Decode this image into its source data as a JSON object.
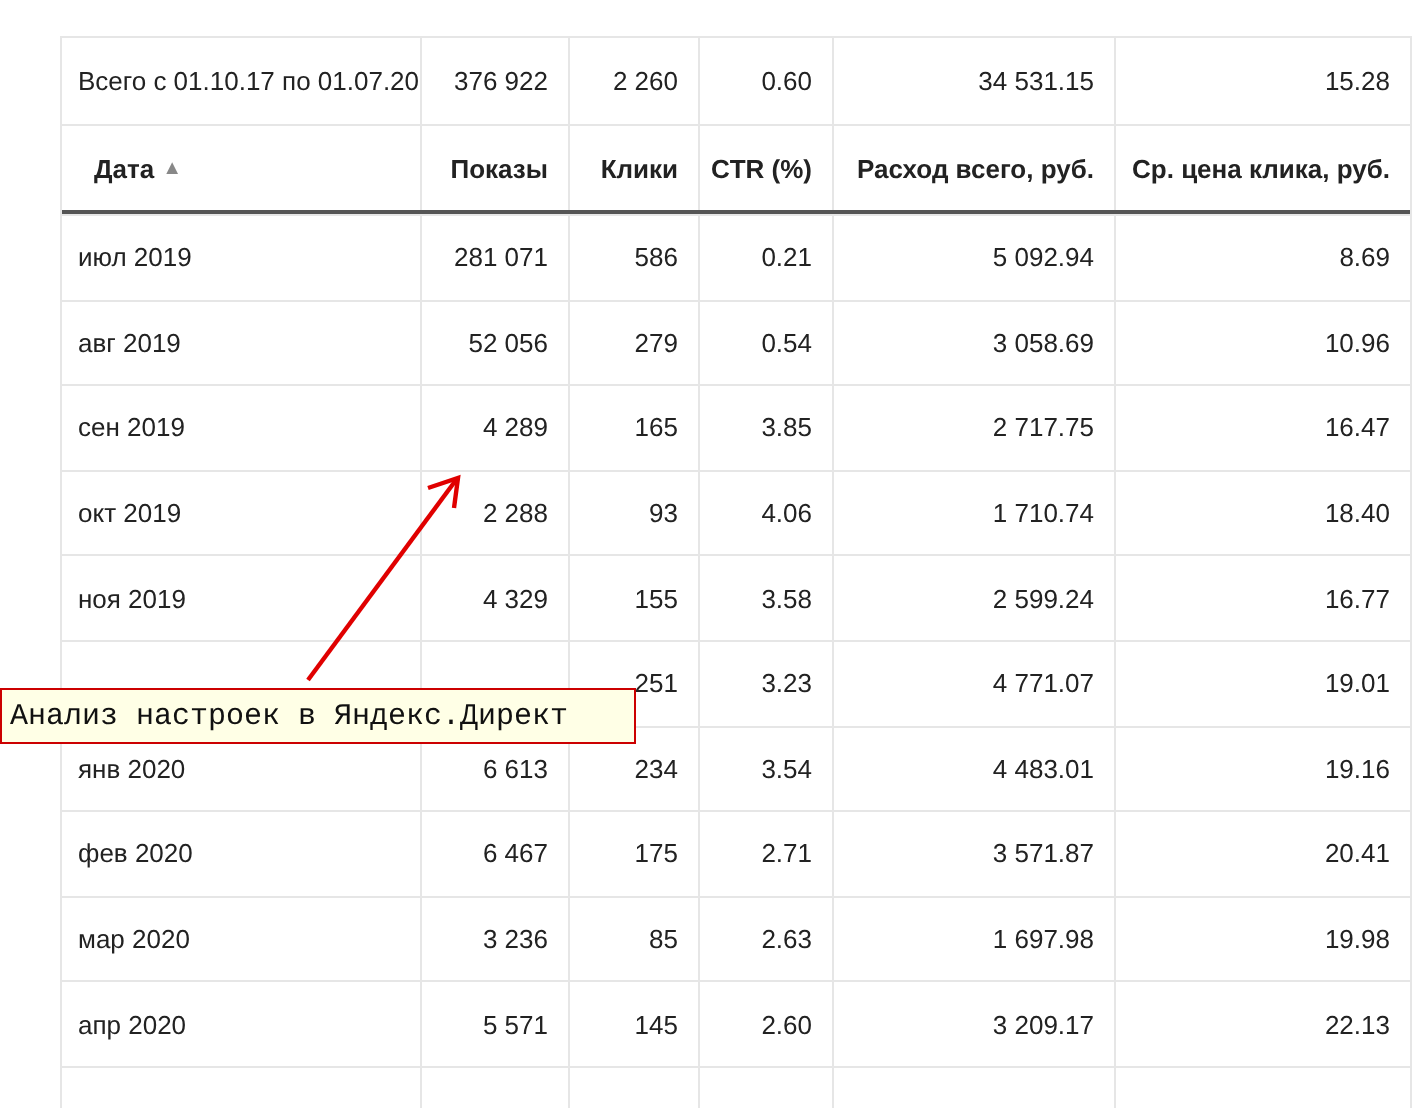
{
  "summary": {
    "label": "Всего с 01.10.17 по 01.07.20",
    "values": [
      "376 922",
      "2 260",
      "0.60",
      "34 531.15",
      "15.28"
    ]
  },
  "columns": [
    {
      "label": "Дата",
      "sort": "▲"
    },
    {
      "label": "Показы"
    },
    {
      "label": "Клики"
    },
    {
      "label": "CTR (%)"
    },
    {
      "label": "Расход всего, руб."
    },
    {
      "label": "Ср. цена клика, руб."
    }
  ],
  "rows": [
    [
      "июл 2019",
      "281 071",
      "586",
      "0.21",
      "5 092.94",
      "8.69"
    ],
    [
      "авг 2019",
      "52 056",
      "279",
      "0.54",
      "3 058.69",
      "10.96"
    ],
    [
      "сен 2019",
      "4 289",
      "165",
      "3.85",
      "2 717.75",
      "16.47"
    ],
    [
      "окт 2019",
      "2 288",
      "93",
      "4.06",
      "1 710.74",
      "18.40"
    ],
    [
      "ноя 2019",
      "4 329",
      "155",
      "3.58",
      "2 599.24",
      "16.77"
    ],
    [
      null,
      null,
      "251",
      "3.23",
      "4 771.07",
      "19.01"
    ],
    [
      "янв 2020",
      "6 613",
      "234",
      "3.54",
      "4 483.01",
      "19.16"
    ],
    [
      "фев 2020",
      "6 467",
      "175",
      "2.71",
      "3 571.87",
      "20.41"
    ],
    [
      "мар 2020",
      "3 236",
      "85",
      "2.63",
      "1 697.98",
      "19.98"
    ],
    [
      "апр 2020",
      "5 571",
      "145",
      "2.60",
      "3 209.17",
      "22.13"
    ]
  ],
  "annotation": {
    "text": "Анализ настроек в Яндекс.Директ"
  }
}
